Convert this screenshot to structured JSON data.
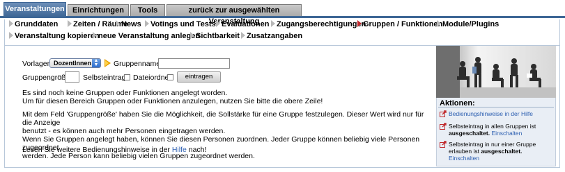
{
  "tabs": [
    {
      "label": "Veranstaltungen",
      "active": true
    },
    {
      "label": "Einrichtungen",
      "active": false
    },
    {
      "label": "Tools",
      "active": false
    },
    {
      "label": "zurück zur ausgewählten Veranstaltung",
      "active": false
    }
  ],
  "subnav": {
    "row1": [
      "Grunddaten",
      "Zeiten / Räume",
      "News",
      "Votings und Tests",
      "Evaluationen",
      "Zugangsberechtigungen",
      "Gruppen / Funktionen",
      "Module/Plugins"
    ],
    "row2": [
      "Veranstaltung kopieren",
      "neue Veranstaltung anlegen",
      "Sichtbarkeit",
      "Zusatzangaben"
    ],
    "active": "Gruppen / Funktionen"
  },
  "form": {
    "vorlagen_label": "Vorlagen:",
    "vorlagen_value": "DozentInnen",
    "gruppenname_label": "Gruppenname:",
    "gruppenname_value": "",
    "groesse_label": "Gruppengröße:",
    "groesse_value": "",
    "selbsteintrag_label": "Selbsteintrag",
    "dateiordner_label": "Dateiordner",
    "submit_label": "eintragen"
  },
  "messages": {
    "p1_line1": "Es sind noch keine Gruppen oder Funktionen angelegt worden.",
    "p1_line2": "Um für diesen Bereich Gruppen oder Funktionen anzulegen, nutzen Sie bitte die obere Zeile!",
    "p2_line1": "Mit dem Feld 'Gruppengröße' haben Sie die Möglichkeit, die Sollstärke für eine Gruppe festzulegen. Dieser Wert wird nur für die Anzeige",
    "p2_line2": "benutzt - es können auch mehr Personen eingetragen werden.",
    "p2_line3": "Wenn Sie Gruppen angelegt haben, können Sie diesen Personen zuordnen. Jeder Gruppe können beliebig viele Personen zugeordnet",
    "p2_line4": "werden. Jede Person kann beliebig vielen Gruppen zugeordnet werden.",
    "p3_prefix": "Lesen Sie weitere Bedienungshinweise in der",
    "p3_link": "Hilfe",
    "p3_suffix": "nach!"
  },
  "sidebar": {
    "title": "Aktionen:",
    "a1_link": "Bedienungshinweise in der Hilfe",
    "a2_text": "Selbsteintrag in allen Gruppen ist",
    "a2_bold": "ausgeschaltet.",
    "a2_link": "Einschalten",
    "a3_text": "Selbsteintrag in nur einer Gruppe erlauben ist",
    "a3_bold": "ausgeschaltet.",
    "a3_link": "Einschalten"
  },
  "colors": {
    "active_tab": "#3e6796",
    "link": "#2a5db0",
    "active_arrow": "#c0282c",
    "action_icon": "#c0282c"
  }
}
